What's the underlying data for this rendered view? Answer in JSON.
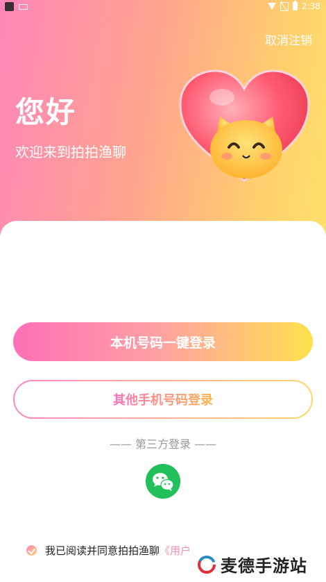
{
  "status_bar": {
    "time": "2:38"
  },
  "header": {
    "cancel_label": "取消注销",
    "greeting": "您好",
    "welcome": "欢迎来到拍拍渔聊"
  },
  "login": {
    "one_key_label": "本机号码一键登录",
    "other_phone_label": "其他手机号码登录",
    "third_party_label": "—— 第三方登录 ——"
  },
  "agreement": {
    "text": "我已阅读并同意拍拍渔聊",
    "link": "《用户"
  },
  "watermark": {
    "text": "麦德手游站"
  },
  "colors": {
    "primary_pink": "#ff6fb7",
    "primary_yellow": "#ffe14f",
    "wechat_green": "#22c05a"
  }
}
